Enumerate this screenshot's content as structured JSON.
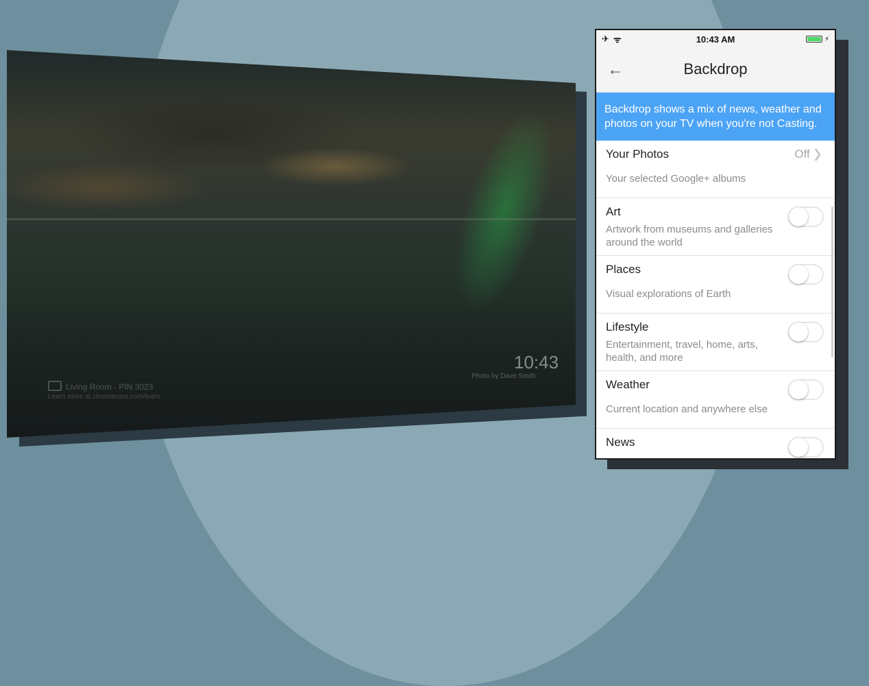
{
  "tv": {
    "clock": "10:43",
    "credit": "Photo by Dave Smith",
    "device_name": "Living Room - PIN 3023",
    "device_url": "Learn more at chromecast.com/learn"
  },
  "phone": {
    "status": {
      "time": "10:43 AM",
      "airplane_icon": "✈",
      "wifi_icon": "ᯤ",
      "charging_icon": "⚡"
    },
    "nav": {
      "back_icon": "←",
      "title": "Backdrop"
    },
    "banner": "Backdrop shows a mix of news, weather and photos on your TV when you're not Casting.",
    "items": [
      {
        "title": "Your Photos",
        "subtitle": "Your selected Google+ albums",
        "value": "Off",
        "chevron": "❯"
      },
      {
        "title": "Art",
        "subtitle": "Artwork from museums and galleries around the world",
        "toggle": false
      },
      {
        "title": "Places",
        "subtitle": "Visual explorations of Earth",
        "toggle": false
      },
      {
        "title": "Lifestyle",
        "subtitle": "Entertainment, travel, home, arts, health, and more",
        "toggle": false
      },
      {
        "title": "Weather",
        "subtitle": "Current location and anywhere else",
        "toggle": false
      },
      {
        "title": "News",
        "subtitle": "",
        "toggle": false
      }
    ]
  }
}
